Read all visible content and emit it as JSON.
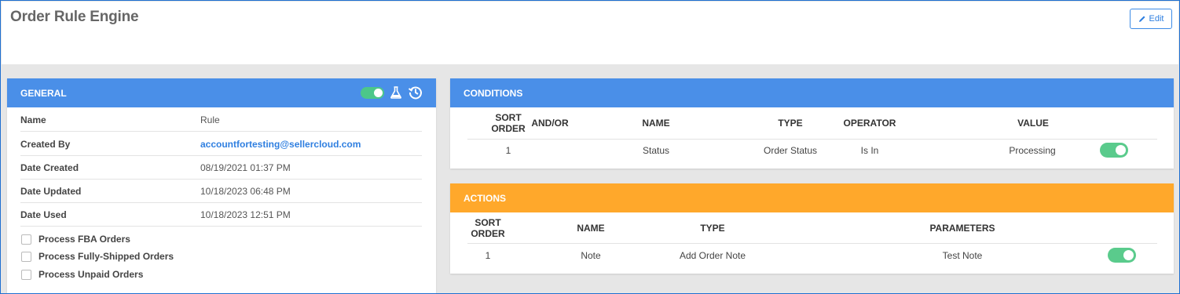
{
  "page": {
    "title": "Order Rule Engine",
    "edit_label": "Edit"
  },
  "general": {
    "title": "GENERAL",
    "enabled": true,
    "icons": [
      "toggle",
      "flask-icon",
      "history-icon"
    ],
    "properties": [
      {
        "label": "Name",
        "value": "Rule"
      },
      {
        "label": "Created By",
        "value": "accountfortesting@sellercloud.com"
      },
      {
        "label": "Date Created",
        "value": "08/19/2021 01:37 PM"
      },
      {
        "label": "Date Updated",
        "value": "10/18/2023 06:48 PM"
      },
      {
        "label": "Date Used",
        "value": "10/18/2023 12:51 PM"
      }
    ],
    "checkboxes": [
      {
        "label": "Process FBA Orders",
        "checked": false
      },
      {
        "label": "Process Fully-Shipped Orders",
        "checked": false
      },
      {
        "label": "Process Unpaid Orders",
        "checked": false
      }
    ]
  },
  "conditions": {
    "title": "CONDITIONS",
    "columns": [
      "SORT ORDER",
      "AND/OR",
      "NAME",
      "TYPE",
      "OPERATOR",
      "VALUE"
    ],
    "rows": [
      {
        "sort_order": "1",
        "and_or": "",
        "name": "Status",
        "type": "Order Status",
        "operator": "Is In",
        "value": "Processing",
        "enabled": true
      }
    ]
  },
  "actions": {
    "title": "ACTIONS",
    "columns": [
      "SORT ORDER",
      "NAME",
      "TYPE",
      "PARAMETERS"
    ],
    "rows": [
      {
        "sort_order": "1",
        "name": "Note",
        "type": "Add Order Note",
        "parameters": "Test Note",
        "enabled": true
      }
    ]
  },
  "colors": {
    "header_blue": "#4a8fe8",
    "header_orange": "#ffa82b",
    "toggle_green": "#5acb8c",
    "link_blue": "#2f7fe0"
  }
}
